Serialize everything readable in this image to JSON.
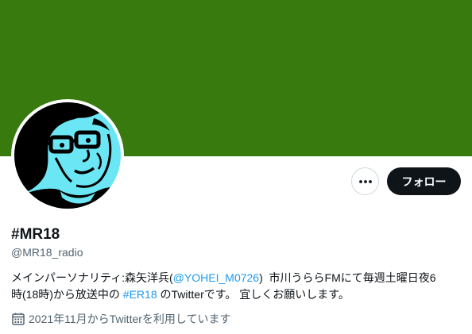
{
  "colors": {
    "banner": "#387a0e",
    "avatar_bg": "#6be6f5",
    "text": "#0f1419",
    "muted": "#536471",
    "link": "#1d9bf0",
    "follow_button": "#0f1419"
  },
  "icons": {
    "more": "more-horizontal-icon",
    "calendar": "calendar-icon"
  },
  "profile": {
    "display_name": "#MR18",
    "handle": "@MR18_radio",
    "bio": {
      "line1": {
        "before": "メインパーソナリティ:森矢洋兵(",
        "mention": "@YOHEI_M0726",
        "after": ")  市川うららFMにて毎週土曜日夜6"
      },
      "line2": {
        "before": "時(18時)から放送中の ",
        "hashtag": "#ER18",
        "after": " のTwitterです。 宜しくお願いします。"
      }
    },
    "joined": "2021年11月からTwitterを利用しています"
  },
  "actions": {
    "follow_label": "フォロー"
  }
}
